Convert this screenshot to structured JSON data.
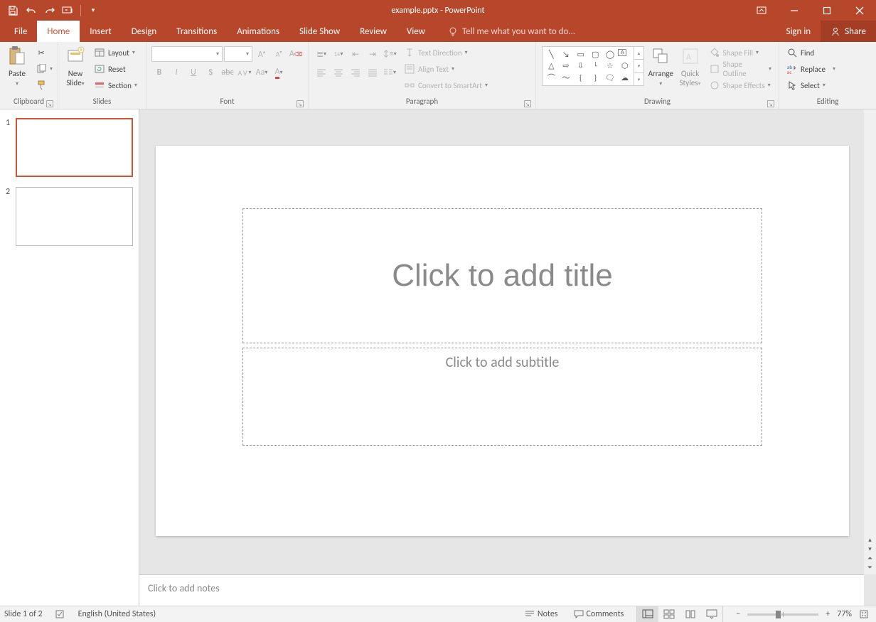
{
  "title": "example.pptx - PowerPoint",
  "tabs": [
    "File",
    "Home",
    "Insert",
    "Design",
    "Transitions",
    "Animations",
    "Slide Show",
    "Review",
    "View"
  ],
  "active_tab": "Home",
  "tellme": "Tell me what you want to do...",
  "signin": "Sign in",
  "share": "Share",
  "groups": {
    "clipboard": {
      "label": "Clipboard",
      "paste": "Paste"
    },
    "slides": {
      "label": "Slides",
      "new_slide": "New\nSlide",
      "layout": "Layout",
      "reset": "Reset",
      "section": "Section"
    },
    "font": {
      "label": "Font"
    },
    "paragraph": {
      "label": "Paragraph",
      "text_direction": "Text Direction",
      "align_text": "Align Text",
      "convert_smartart": "Convert to SmartArt"
    },
    "drawing": {
      "label": "Drawing",
      "arrange": "Arrange",
      "quick_styles": "Quick\nStyles",
      "shape_fill": "Shape Fill",
      "shape_outline": "Shape Outline",
      "shape_effects": "Shape Effects"
    },
    "editing": {
      "label": "Editing",
      "find": "Find",
      "replace": "Replace",
      "select": "Select"
    }
  },
  "thumbs": [
    {
      "num": "1",
      "selected": true
    },
    {
      "num": "2",
      "selected": false
    }
  ],
  "placeholders": {
    "title": "Click to add title",
    "subtitle": "Click to add subtitle"
  },
  "notes_placeholder": "Click to add notes",
  "status": {
    "slide": "Slide 1 of 2",
    "lang": "English (United States)",
    "notes": "Notes",
    "comments": "Comments",
    "zoom": "77%"
  }
}
